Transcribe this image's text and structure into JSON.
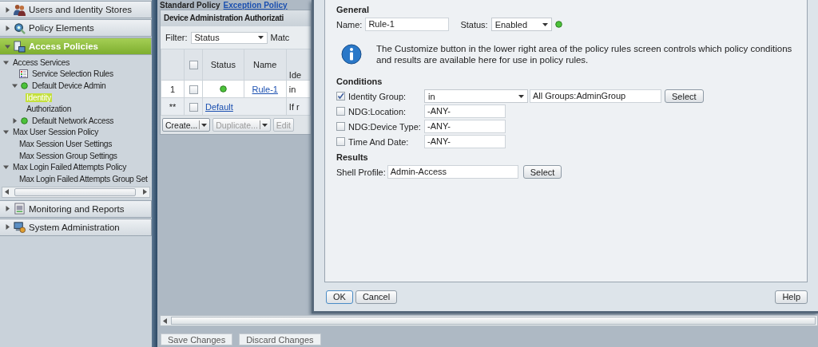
{
  "sidebar": {
    "sections": [
      {
        "label": "Users and Identity Stores",
        "kind": "users",
        "expanded": false,
        "selected": false
      },
      {
        "label": "Policy Elements",
        "kind": "elements",
        "expanded": false,
        "selected": false
      },
      {
        "label": "Access Policies",
        "kind": "access",
        "expanded": true,
        "selected": true,
        "tree": [
          {
            "label": "Access Services",
            "expanded": true,
            "selected": false,
            "children": [
              {
                "label": "Service Selection Rules",
                "kind": "rules",
                "selected": false
              },
              {
                "label": "Default Device Admin",
                "kind": "service",
                "expanded": true,
                "selected": false,
                "children": [
                  {
                    "label": "Identity",
                    "selected": true
                  },
                  {
                    "label": "Authorization",
                    "selected": false
                  }
                ]
              },
              {
                "label": "Default Network Access",
                "kind": "service",
                "expanded": false,
                "selected": false
              }
            ]
          },
          {
            "label": "Max User Session Policy",
            "expanded": true,
            "selected": false,
            "children": [
              {
                "label": "Max Session User Settings",
                "selected": false
              },
              {
                "label": "Max Session Group Settings",
                "selected": false
              }
            ]
          },
          {
            "label": "Max Login Failed Attempts Policy",
            "expanded": true,
            "selected": false,
            "children": [
              {
                "label": "Max Login Failed Attempts Group Set",
                "selected": false
              }
            ]
          }
        ]
      },
      {
        "label": "Monitoring and Reports",
        "kind": "monitoring",
        "expanded": false,
        "selected": false
      },
      {
        "label": "System Administration",
        "kind": "system",
        "expanded": false,
        "selected": false
      }
    ]
  },
  "policy": {
    "tabs": [
      {
        "label": "Standard Policy",
        "selected": true
      },
      {
        "label": "Exception Policy",
        "selected": false
      }
    ],
    "title": "Device Administration Authorizati",
    "filter": {
      "label": "Filter:",
      "value": "Status",
      "match_label": "Matc"
    },
    "columns": [
      "Status",
      "Name",
      "Ide"
    ],
    "header_checked": false,
    "rows": [
      {
        "kind": "rule",
        "index": "1",
        "checked": false,
        "enabled": true,
        "name": "Rule-1",
        "column_3": "in"
      },
      {
        "kind": "default",
        "index": "**",
        "checked": false,
        "name": "Default",
        "column_3": "If r"
      }
    ],
    "buttons": [
      {
        "label": "Create...",
        "menu": true,
        "disabled": false
      },
      {
        "label": "Duplicate...",
        "menu": true,
        "disabled": true
      },
      {
        "label": "Edit",
        "menu": false,
        "disabled": true
      }
    ]
  },
  "dialog": {
    "general": {
      "heading": "General",
      "name_label": "Name:",
      "name_value": "Rule-1",
      "status_label": "Status:",
      "status_value": "Enabled",
      "enabled": true
    },
    "info": "The Customize button in the lower right area of the policy rules screen controls which policy conditions and results are available here for use in policy rules.",
    "conditions": {
      "heading": "Conditions",
      "rows": [
        {
          "kind": "operator",
          "label": "Identity Group:",
          "checked": true,
          "operator": "in",
          "value": "All Groups:AdminGroup",
          "button": "Select"
        },
        {
          "kind": "plain",
          "label": "NDG:Location:",
          "checked": false,
          "value": "-ANY-"
        },
        {
          "kind": "plain",
          "label": "NDG:Device Type:",
          "checked": false,
          "value": "-ANY-"
        },
        {
          "kind": "plain",
          "label": "Time And Date:",
          "checked": false,
          "value": "-ANY-"
        }
      ]
    },
    "results": {
      "heading": "Results",
      "label": "Shell Profile:",
      "value": "Admin-Access",
      "button": "Select"
    },
    "ok": "OK",
    "cancel": "Cancel",
    "help": "Help"
  },
  "footer": {
    "save": "Save Changes",
    "discard": "Discard Changes"
  }
}
